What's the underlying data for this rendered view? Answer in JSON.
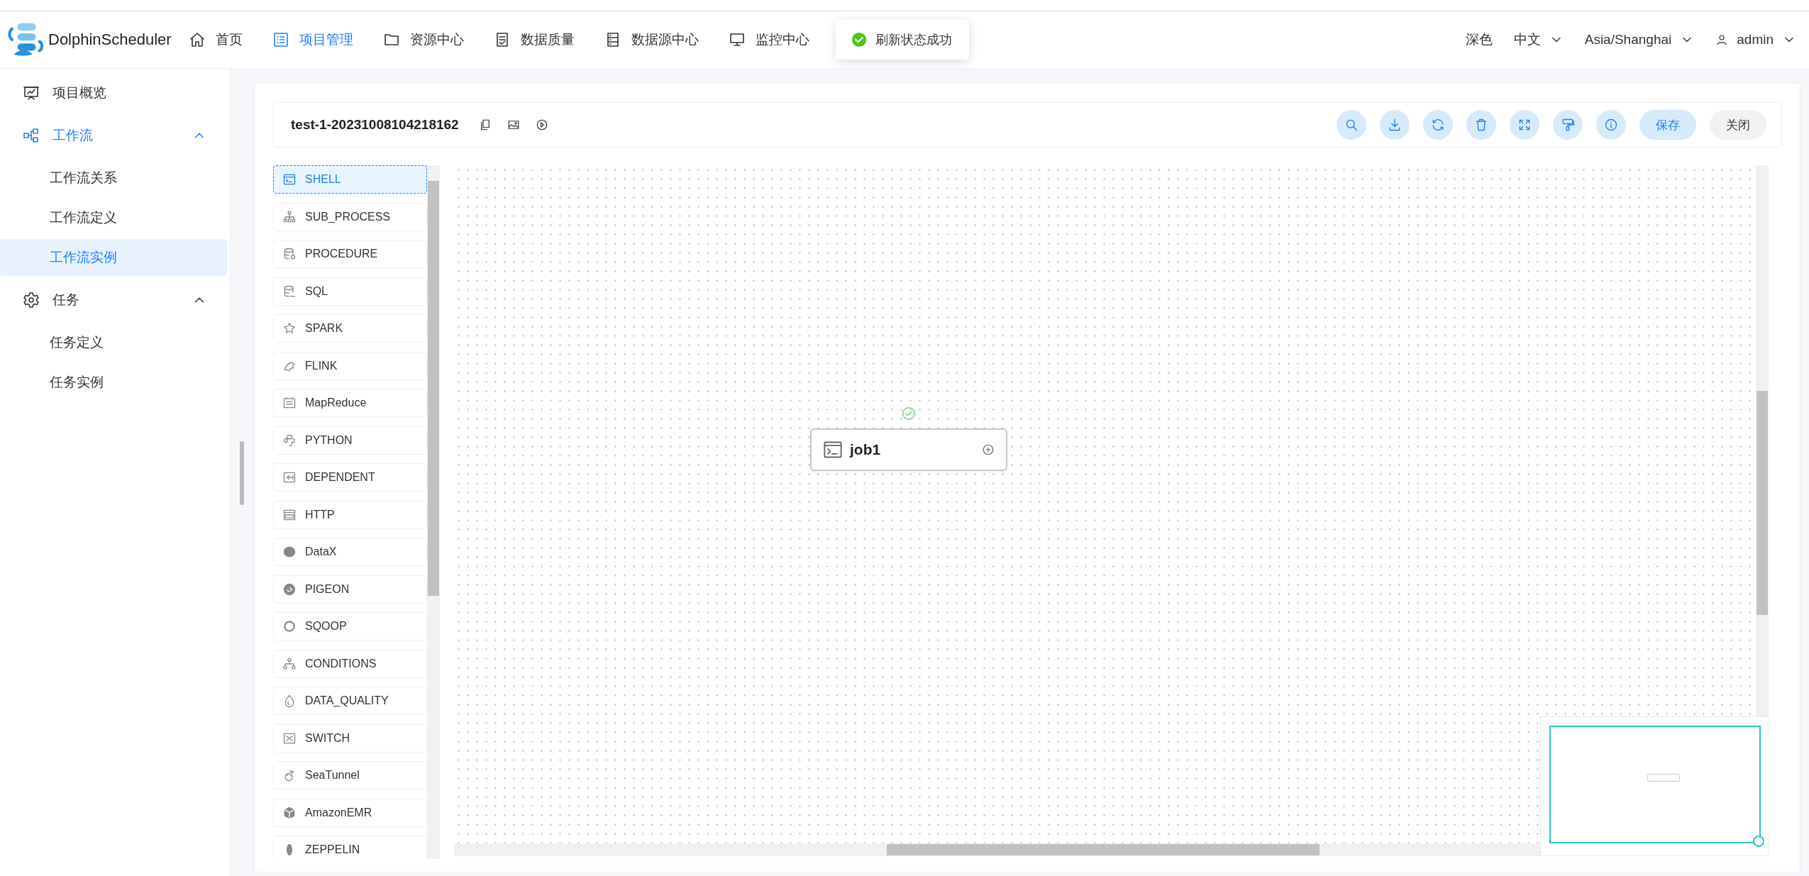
{
  "header": {
    "logo": "DolphinScheduler",
    "nav": [
      {
        "label": "首页",
        "selected": false
      },
      {
        "label": "项目管理",
        "selected": true
      },
      {
        "label": "资源中心",
        "selected": false
      },
      {
        "label": "数据质量",
        "selected": false
      },
      {
        "label": "数据源中心",
        "selected": false
      },
      {
        "label": "监控中心",
        "selected": false
      }
    ],
    "toast": "刷新状态成功",
    "theme": "深色",
    "language": "中文",
    "timezone": "Asia/Shanghai",
    "user": "admin"
  },
  "sidebar": {
    "items": [
      {
        "label": "项目概览",
        "selected": false
      },
      {
        "label": "工作流",
        "selected": true,
        "expanded": true,
        "children": [
          {
            "label": "工作流关系",
            "selected": false
          },
          {
            "label": "工作流定义",
            "selected": false
          },
          {
            "label": "工作流实例",
            "selected": true
          }
        ]
      },
      {
        "label": "任务",
        "selected": false,
        "expanded": true,
        "children": [
          {
            "label": "任务定义",
            "selected": false
          },
          {
            "label": "任务实例",
            "selected": false
          }
        ]
      }
    ]
  },
  "toolbar": {
    "title": "test-1-20231008104218162",
    "save": "保存",
    "close": "关闭"
  },
  "tasks": [
    {
      "label": "SHELL",
      "selected": true
    },
    {
      "label": "SUB_PROCESS",
      "selected": false
    },
    {
      "label": "PROCEDURE",
      "selected": false
    },
    {
      "label": "SQL",
      "selected": false
    },
    {
      "label": "SPARK",
      "selected": false
    },
    {
      "label": "FLINK",
      "selected": false
    },
    {
      "label": "MapReduce",
      "selected": false
    },
    {
      "label": "PYTHON",
      "selected": false
    },
    {
      "label": "DEPENDENT",
      "selected": false
    },
    {
      "label": "HTTP",
      "selected": false
    },
    {
      "label": "DataX",
      "selected": false
    },
    {
      "label": "PIGEON",
      "selected": false
    },
    {
      "label": "SQOOP",
      "selected": false
    },
    {
      "label": "CONDITIONS",
      "selected": false
    },
    {
      "label": "DATA_QUALITY",
      "selected": false
    },
    {
      "label": "SWITCH",
      "selected": false
    },
    {
      "label": "SeaTunnel",
      "selected": false
    },
    {
      "label": "AmazonEMR",
      "selected": false
    },
    {
      "label": "ZEPPELIN",
      "selected": false
    }
  ],
  "canvas": {
    "nodes": [
      {
        "label": "job1",
        "completed": true
      }
    ]
  }
}
